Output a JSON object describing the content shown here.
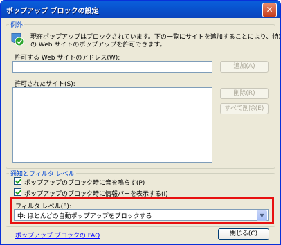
{
  "window": {
    "title": "ポップアップ ブロックの設定",
    "close_glyph": "✕"
  },
  "exceptions": {
    "legend": "例外",
    "info_text_line1": "現在ポップアップはブロックされています。下の一覧にサイトを追加することにより、特定",
    "info_text_line2": "の Web サイトのポップアップを許可できます。",
    "address_label": "許可する Web サイトのアドレス(W):",
    "address_value": "",
    "add_button": "追加(A)",
    "allowed_label": "許可されたサイト(S):",
    "allowed_sites": [],
    "remove_button": "削除(R)",
    "remove_all_button": "すべて削除(E)"
  },
  "notifications": {
    "legend": "通知とフィルタ レベル",
    "play_sound_label": "ポップアップのブロック時に音を鳴らす(P)",
    "play_sound_checked": true,
    "show_infobar_label": "ポップアップのブロック時に情報バーを表示する(I)",
    "show_infobar_checked": true,
    "filter_label": "フィルタ レベル(F):",
    "filter_value": "中: ほとんどの自動ポップアップをブロックする"
  },
  "footer": {
    "faq_link": "ポップアップ ブロックの FAQ",
    "close_button": "閉じる(C)"
  },
  "colors": {
    "title_bar": "#0854d0",
    "legend_text": "#0046d5",
    "highlight": "#e81010",
    "link": "#0000ff"
  },
  "icons": {
    "info_icon": "shield-check-icon"
  }
}
